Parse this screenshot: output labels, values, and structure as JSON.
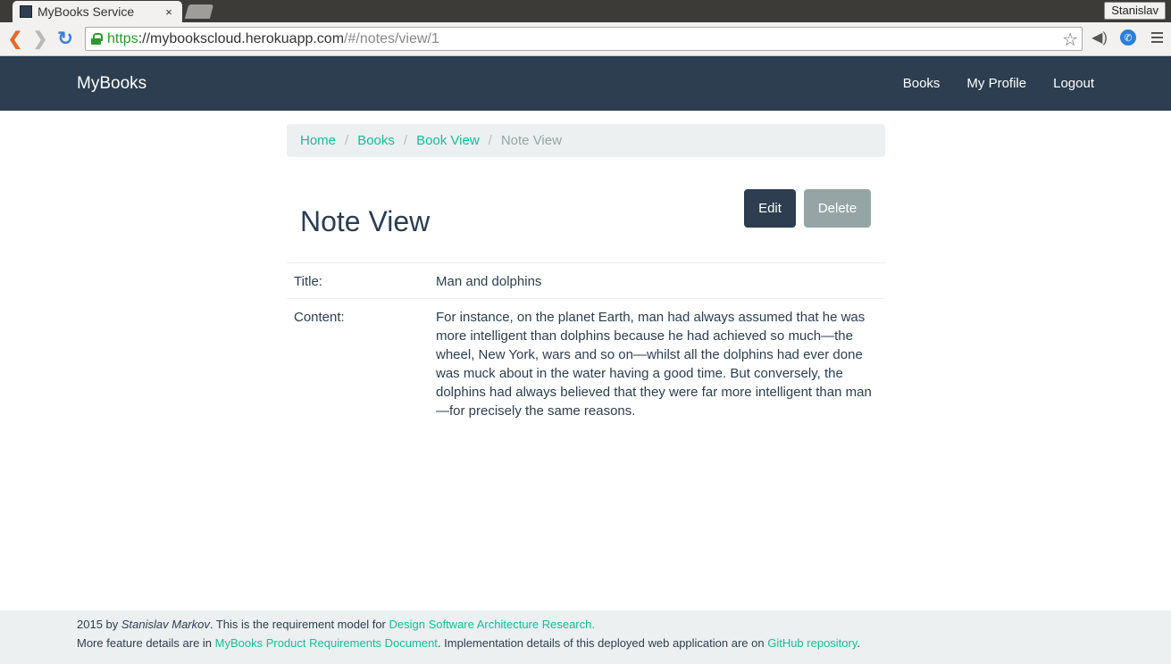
{
  "browser": {
    "tab_title": "MyBooks Service",
    "tab_close": "×",
    "user_name": "Stanislav",
    "url_scheme": "https",
    "url_host": "://mybookscloud.herokuapp.com",
    "url_path": "/#/notes/view/1"
  },
  "navbar": {
    "brand": "MyBooks",
    "links": [
      "Books",
      "My Profile",
      "Logout"
    ]
  },
  "breadcrumb": {
    "items": [
      "Home",
      "Books",
      "Book View"
    ],
    "separator": "/",
    "active": "Note View"
  },
  "page": {
    "title": "Note View",
    "edit_label": "Edit",
    "delete_label": "Delete"
  },
  "note": {
    "title_label": "Title:",
    "title_value": "Man and dolphins",
    "content_label": "Content:",
    "content_value": "For instance, on the planet Earth, man had always assumed that he was more intelligent than dolphins because he had achieved so much—the wheel, New York, wars and so on—whilst all the dolphins had ever done was muck about in the water having a good time. But conversely, the dolphins had always believed that they were far more intelligent than man—for precisely the same reasons."
  },
  "footer": {
    "line1_prefix": "2015 by ",
    "author": "Stanislav Markov",
    "line1_middle": ". This is the requirement model for ",
    "line1_link": "Design Software Architecture Research.",
    "line2_prefix": "More feature details are in ",
    "line2_link1": "MyBooks Product Requirements Document",
    "line2_middle": ". Implementation details of this deployed web application are on ",
    "line2_link2": "GitHub repository",
    "line2_suffix": "."
  },
  "colors": {
    "navbar_bg": "#2c3e50",
    "link": "#18bc9c",
    "muted": "#95a5a6",
    "light_bg": "#ecf0f1"
  },
  "icons": [
    "back-arrow-icon",
    "forward-arrow-icon",
    "reload-icon",
    "lock-icon",
    "star-icon",
    "extension-icon",
    "phone-extension-icon",
    "menu-icon"
  ]
}
